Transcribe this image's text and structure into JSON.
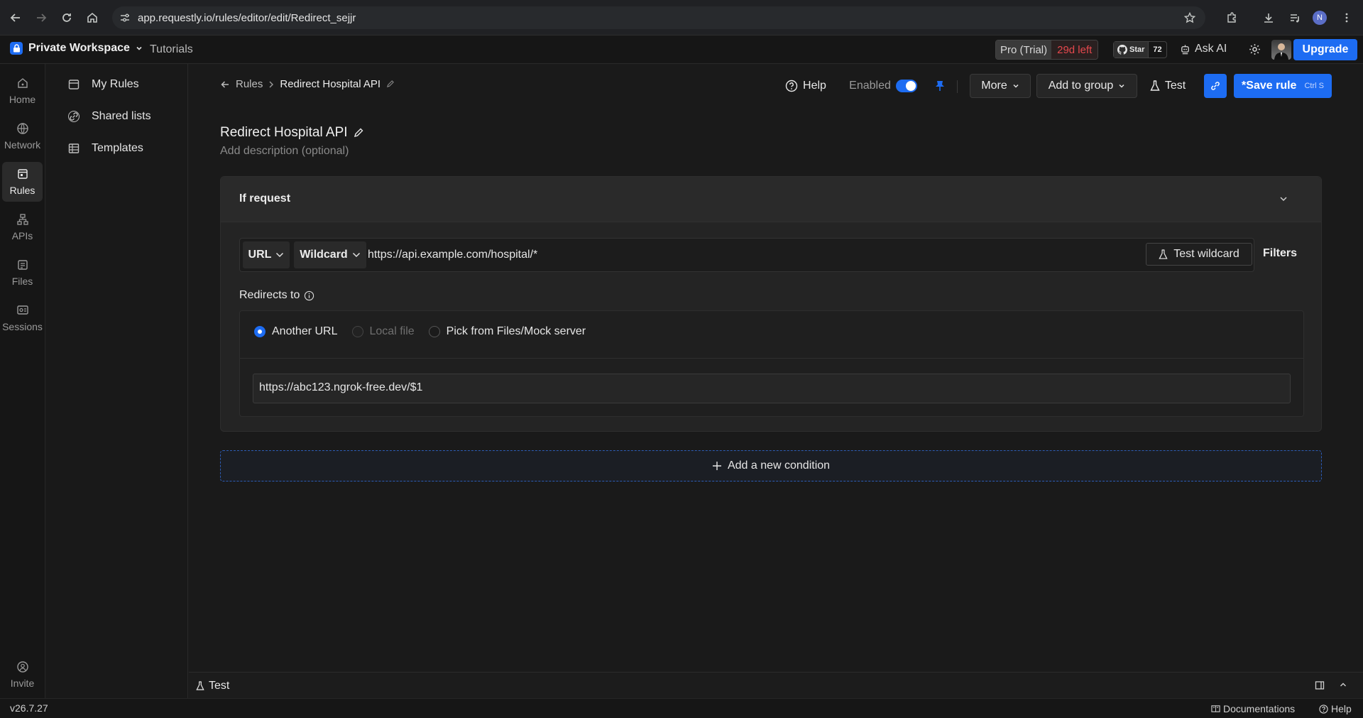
{
  "browser": {
    "url": "app.requestly.io/rules/editor/edit/Redirect_sejjr",
    "profile_initial": "N"
  },
  "appbar": {
    "workspace": "Private Workspace",
    "tutorials": "Tutorials",
    "plan": "Pro (Trial)",
    "trial_left": "29d left",
    "github_star": "Star",
    "github_count": "72",
    "ask_ai": "Ask AI",
    "upgrade": "Upgrade"
  },
  "rail": {
    "items": [
      {
        "label": "Home",
        "icon": "home-icon"
      },
      {
        "label": "Network",
        "icon": "globe-icon"
      },
      {
        "label": "Rules",
        "icon": "rules-icon",
        "active": true
      },
      {
        "label": "APIs",
        "icon": "api-icon"
      },
      {
        "label": "Files",
        "icon": "files-icon"
      },
      {
        "label": "Sessions",
        "icon": "sessions-icon"
      }
    ],
    "invite": "Invite",
    "version": "v26.7.27"
  },
  "sidebar": {
    "items": [
      {
        "label": "My Rules",
        "icon": "rules-list-icon"
      },
      {
        "label": "Shared lists",
        "icon": "link-icon"
      },
      {
        "label": "Templates",
        "icon": "table-icon"
      }
    ]
  },
  "editor": {
    "breadcrumb_root": "Rules",
    "breadcrumb_current": "Redirect Hospital API",
    "help": "Help",
    "enabled_label": "Enabled",
    "enabled": true,
    "more": "More",
    "add_to_group": "Add to group",
    "test": "Test",
    "save_rule": "*Save rule",
    "save_shortcut": "Ctrl S",
    "title": "Redirect Hospital API",
    "description_placeholder": "Add description (optional)",
    "condition": {
      "heading": "If request",
      "match_field": "URL",
      "operator": "Wildcard",
      "value": "https://api.example.com/hospital/*",
      "test_wildcard": "Test wildcard",
      "filters": "Filters"
    },
    "redirect": {
      "label": "Redirects to",
      "options": [
        {
          "label": "Another URL",
          "selected": true,
          "disabled": false
        },
        {
          "label": "Local file",
          "selected": false,
          "disabled": true
        },
        {
          "label": "Pick from Files/Mock server",
          "selected": false,
          "disabled": false
        }
      ],
      "destination": "https://abc123.ngrok-free.dev/$1"
    },
    "add_condition": "Add a new condition"
  },
  "test_panel": {
    "label": "Test"
  },
  "footer": {
    "documentation": "Documentations",
    "help": "Help"
  },
  "colors": {
    "accent": "#1d6cf2",
    "trial_red": "#e5484d",
    "background": "#1a1a1a"
  }
}
